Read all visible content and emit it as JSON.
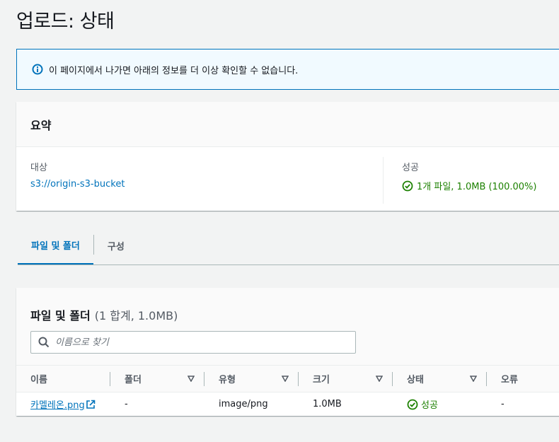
{
  "page": {
    "title": "업로드: 상태"
  },
  "alert": {
    "text": "이 페이지에서 나가면 아래의 정보를 더 이상 확인할 수 없습니다.",
    "icon": "info-icon"
  },
  "summary": {
    "title": "요약",
    "destination_label": "대상",
    "destination_value": "s3://origin-s3-bucket",
    "success_label": "성공",
    "success_value": "1개 파일, 1.0MB (100.00%)"
  },
  "tabs": [
    {
      "label": "파일 및 폴더",
      "active": true
    },
    {
      "label": "구성",
      "active": false
    }
  ],
  "files": {
    "title": "파일 및 폴더",
    "count": "(1 합계, 1.0MB)",
    "search_placeholder": "이름으로 찾기",
    "columns": [
      "이름",
      "폴더",
      "유형",
      "크기",
      "상태",
      "오류"
    ],
    "rows": [
      {
        "name": "카멜레온.png",
        "folder": "-",
        "type": "image/png",
        "size": "1.0MB",
        "status": "성공",
        "error": "-"
      }
    ]
  },
  "colors": {
    "accent": "#0073bb",
    "success": "#1d8102",
    "alert_bg": "#f1faff"
  }
}
